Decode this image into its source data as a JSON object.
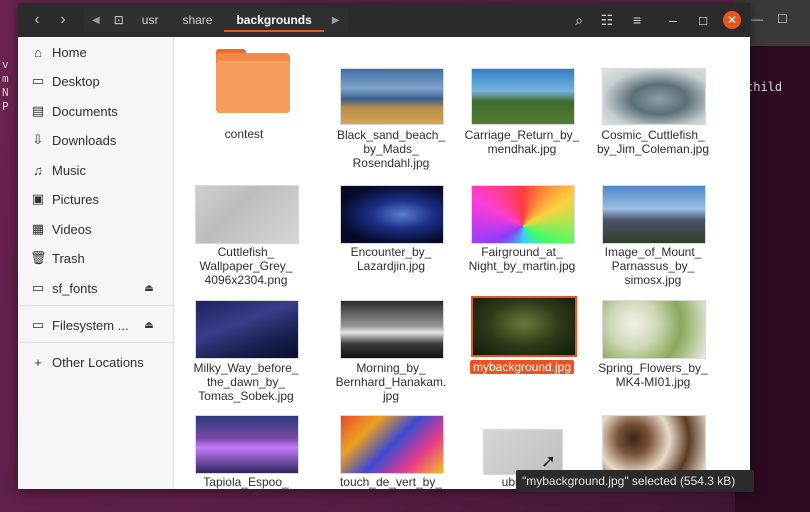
{
  "background": {
    "terminal_text": "child",
    "left_chars": [
      "v",
      "m",
      "N",
      "P"
    ]
  },
  "header": {
    "back_icon": "chevron-left-icon",
    "forward_icon": "chevron-right-icon",
    "breadcrumb": [
      "usr",
      "share",
      "backgrounds"
    ],
    "active_crumb": "backgrounds"
  },
  "sidebar": {
    "items": [
      {
        "label": "Home",
        "icon": "home-icon"
      },
      {
        "label": "Desktop",
        "icon": "desktop-icon"
      },
      {
        "label": "Documents",
        "icon": "documents-icon"
      },
      {
        "label": "Downloads",
        "icon": "downloads-icon"
      },
      {
        "label": "Music",
        "icon": "music-icon"
      },
      {
        "label": "Pictures",
        "icon": "pictures-icon"
      },
      {
        "label": "Videos",
        "icon": "videos-icon"
      },
      {
        "label": "Trash",
        "icon": "trash-icon"
      },
      {
        "label": "sf_fonts",
        "icon": "drive-icon"
      },
      {
        "label": "Filesystem ...",
        "icon": "drive-icon"
      },
      {
        "label": "Other Locations",
        "icon": "plus-icon"
      }
    ]
  },
  "files": [
    {
      "name": "contest",
      "type": "folder"
    },
    {
      "name": "Black_sand_beach_\nby_Mads_\nRosendahl.jpg"
    },
    {
      "name": "Carriage_Return_by_\nmendhak.jpg"
    },
    {
      "name": "Cosmic_Cuttlefish_\nby_Jim_Coleman.jpg"
    },
    {
      "name": "Cuttlefish_\nWallpaper_Grey_\n4096x2304.png"
    },
    {
      "name": "Encounter_by_\nLazardjin.jpg"
    },
    {
      "name": "Fairground_at_\nNight_by_martin.jpg"
    },
    {
      "name": "Image_of_Mount_\nParnassus_by_\nsimosx.jpg"
    },
    {
      "name": "Milky_Way_before_\nthe_dawn_by_\nTomas_Sobek.jpg"
    },
    {
      "name": "Morning_by_\nBernhard_Hanakam.\njpg"
    },
    {
      "name": "mybackground.jpg",
      "selected": true
    },
    {
      "name": "Spring_Flowers_by_\nMK4-MI01.jpg"
    },
    {
      "name": "Tapiola_Espoo_"
    },
    {
      "name": "touch_de_vert_by_"
    },
    {
      "name": "ubuntu-"
    },
    {
      "name": ""
    }
  ],
  "status": {
    "text": "\"mybackground.jpg\" selected  (554.3 kB)"
  },
  "colors": {
    "accent": "#e95420",
    "headerbar": "#2b2b2b"
  }
}
